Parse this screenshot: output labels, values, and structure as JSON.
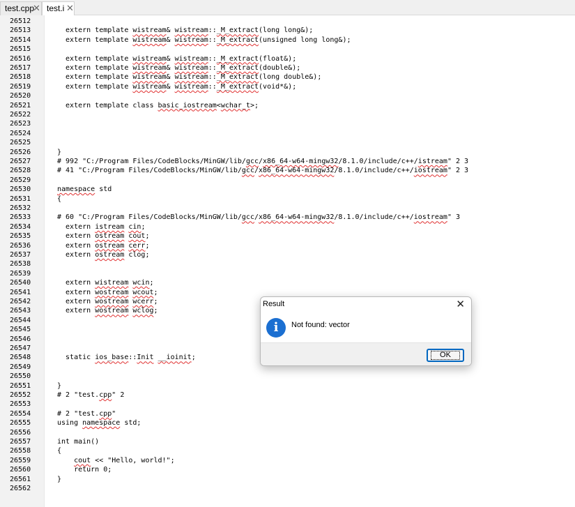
{
  "tabs": [
    {
      "label": "test.cpp",
      "close": "✕"
    },
    {
      "label": "test.i",
      "close": "✕"
    }
  ],
  "editor": {
    "lines": [
      {
        "no": "26512",
        "parts": []
      },
      {
        "no": "26513",
        "parts": [
          {
            "t": "  extern template "
          },
          {
            "t": "wistream",
            "w": true
          },
          {
            "t": "& "
          },
          {
            "t": "wistream",
            "w": true
          },
          {
            "t": "::"
          },
          {
            "t": "_M_extract",
            "w": true
          },
          {
            "t": "(long long&);"
          }
        ]
      },
      {
        "no": "26514",
        "parts": [
          {
            "t": "  extern template "
          },
          {
            "t": "wistream",
            "w": true
          },
          {
            "t": "& "
          },
          {
            "t": "wistream",
            "w": true
          },
          {
            "t": "::"
          },
          {
            "t": "_M_extract",
            "w": true
          },
          {
            "t": "(unsigned long long&);"
          }
        ]
      },
      {
        "no": "26515",
        "parts": []
      },
      {
        "no": "26516",
        "parts": [
          {
            "t": "  extern template "
          },
          {
            "t": "wistream",
            "w": true
          },
          {
            "t": "& "
          },
          {
            "t": "wistream",
            "w": true
          },
          {
            "t": "::"
          },
          {
            "t": "_M_extract",
            "w": true
          },
          {
            "t": "(float&);"
          }
        ]
      },
      {
        "no": "26517",
        "parts": [
          {
            "t": "  extern template "
          },
          {
            "t": "wistream",
            "w": true
          },
          {
            "t": "& "
          },
          {
            "t": "wistream",
            "w": true
          },
          {
            "t": "::"
          },
          {
            "t": "_M_extract",
            "w": true
          },
          {
            "t": "(double&);"
          }
        ]
      },
      {
        "no": "26518",
        "parts": [
          {
            "t": "  extern template "
          },
          {
            "t": "wistream",
            "w": true
          },
          {
            "t": "& "
          },
          {
            "t": "wistream",
            "w": true
          },
          {
            "t": "::"
          },
          {
            "t": "_M_extract",
            "w": true
          },
          {
            "t": "(long double&);"
          }
        ]
      },
      {
        "no": "26519",
        "parts": [
          {
            "t": "  extern template "
          },
          {
            "t": "wistream",
            "w": true
          },
          {
            "t": "& "
          },
          {
            "t": "wistream",
            "w": true
          },
          {
            "t": "::"
          },
          {
            "t": "_M_extract",
            "w": true
          },
          {
            "t": "(void*&);"
          }
        ]
      },
      {
        "no": "26520",
        "parts": []
      },
      {
        "no": "26521",
        "parts": [
          {
            "t": "  extern template class "
          },
          {
            "t": "basic_iostream",
            "w": true
          },
          {
            "t": "<"
          },
          {
            "t": "wchar_t",
            "w": true
          },
          {
            "t": ">;"
          }
        ]
      },
      {
        "no": "26522",
        "parts": []
      },
      {
        "no": "26523",
        "parts": []
      },
      {
        "no": "26524",
        "parts": []
      },
      {
        "no": "26525",
        "parts": []
      },
      {
        "no": "26526",
        "parts": [
          {
            "t": "}"
          }
        ]
      },
      {
        "no": "26527",
        "parts": [
          {
            "t": "# 992 \"C:/Program Files/CodeBlocks/MinGW/lib/"
          },
          {
            "t": "gcc",
            "w": true
          },
          {
            "t": "/"
          },
          {
            "t": "x86_64-w64-mingw32",
            "w": true
          },
          {
            "t": "/8.1.0/include/c++/"
          },
          {
            "t": "istream",
            "w": true
          },
          {
            "t": "\" 2 3"
          }
        ]
      },
      {
        "no": "26528",
        "parts": [
          {
            "t": "# 41 \"C:/Program Files/CodeBlocks/MinGW/lib/"
          },
          {
            "t": "gcc",
            "w": true
          },
          {
            "t": "/"
          },
          {
            "t": "x86_64-w64-mingw32",
            "w": true
          },
          {
            "t": "/8.1.0/include/c++/"
          },
          {
            "t": "iostream",
            "w": true
          },
          {
            "t": "\" 2 3"
          }
        ]
      },
      {
        "no": "26529",
        "parts": []
      },
      {
        "no": "26530",
        "parts": [
          {
            "t": "namespace",
            "w": true
          },
          {
            "t": " std"
          }
        ]
      },
      {
        "no": "26531",
        "parts": [
          {
            "t": "{"
          }
        ]
      },
      {
        "no": "26532",
        "parts": []
      },
      {
        "no": "26533",
        "parts": [
          {
            "t": "# 60 \"C:/Program Files/CodeBlocks/MinGW/lib/"
          },
          {
            "t": "gcc",
            "w": true
          },
          {
            "t": "/"
          },
          {
            "t": "x86_64-w64-mingw32",
            "w": true
          },
          {
            "t": "/8.1.0/include/c++/"
          },
          {
            "t": "iostream",
            "w": true
          },
          {
            "t": "\" 3"
          }
        ]
      },
      {
        "no": "26534",
        "parts": [
          {
            "t": "  extern "
          },
          {
            "t": "istream",
            "w": true
          },
          {
            "t": " "
          },
          {
            "t": "cin",
            "w": true
          },
          {
            "t": ";"
          }
        ]
      },
      {
        "no": "26535",
        "parts": [
          {
            "t": "  extern "
          },
          {
            "t": "ostream",
            "w": true
          },
          {
            "t": " "
          },
          {
            "t": "cout",
            "w": true
          },
          {
            "t": ";"
          }
        ]
      },
      {
        "no": "26536",
        "parts": [
          {
            "t": "  extern "
          },
          {
            "t": "ostream",
            "w": true
          },
          {
            "t": " "
          },
          {
            "t": "cerr",
            "w": true
          },
          {
            "t": ";"
          }
        ]
      },
      {
        "no": "26537",
        "parts": [
          {
            "t": "  extern "
          },
          {
            "t": "ostream",
            "w": true
          },
          {
            "t": " clog;"
          }
        ]
      },
      {
        "no": "26538",
        "parts": []
      },
      {
        "no": "26539",
        "parts": []
      },
      {
        "no": "26540",
        "parts": [
          {
            "t": "  extern "
          },
          {
            "t": "wistream",
            "w": true
          },
          {
            "t": " "
          },
          {
            "t": "wcin",
            "w": true
          },
          {
            "t": ";"
          }
        ]
      },
      {
        "no": "26541",
        "parts": [
          {
            "t": "  extern "
          },
          {
            "t": "wostream",
            "w": true
          },
          {
            "t": " "
          },
          {
            "t": "wcout",
            "w": true
          },
          {
            "t": ";"
          }
        ]
      },
      {
        "no": "26542",
        "parts": [
          {
            "t": "  extern "
          },
          {
            "t": "wostream",
            "w": true
          },
          {
            "t": " "
          },
          {
            "t": "wcerr",
            "w": true
          },
          {
            "t": ";"
          }
        ]
      },
      {
        "no": "26543",
        "parts": [
          {
            "t": "  extern "
          },
          {
            "t": "wostream",
            "w": true
          },
          {
            "t": " "
          },
          {
            "t": "wclog",
            "w": true
          },
          {
            "t": ";"
          }
        ]
      },
      {
        "no": "26544",
        "parts": []
      },
      {
        "no": "26545",
        "parts": []
      },
      {
        "no": "26546",
        "parts": []
      },
      {
        "no": "26547",
        "parts": []
      },
      {
        "no": "26548",
        "parts": [
          {
            "t": "  static "
          },
          {
            "t": "ios_base",
            "w": true
          },
          {
            "t": "::"
          },
          {
            "t": "Init",
            "w": true
          },
          {
            "t": " "
          },
          {
            "t": "__ioinit",
            "w": true
          },
          {
            "t": ";"
          }
        ]
      },
      {
        "no": "26549",
        "parts": []
      },
      {
        "no": "26550",
        "parts": []
      },
      {
        "no": "26551",
        "parts": [
          {
            "t": "}"
          }
        ]
      },
      {
        "no": "26552",
        "parts": [
          {
            "t": "# 2 \"test."
          },
          {
            "t": "cpp",
            "w": true
          },
          {
            "t": "\" 2"
          }
        ]
      },
      {
        "no": "26553",
        "parts": []
      },
      {
        "no": "26554",
        "parts": [
          {
            "t": "# 2 \"test."
          },
          {
            "t": "cpp",
            "w": true
          },
          {
            "t": "\""
          }
        ]
      },
      {
        "no": "26555",
        "parts": [
          {
            "t": "using "
          },
          {
            "t": "namespace",
            "w": true
          },
          {
            "t": " std;"
          }
        ]
      },
      {
        "no": "26556",
        "parts": []
      },
      {
        "no": "26557",
        "parts": [
          {
            "t": "int main()"
          }
        ]
      },
      {
        "no": "26558",
        "parts": [
          {
            "t": "{"
          }
        ]
      },
      {
        "no": "26559",
        "parts": [
          {
            "t": "    "
          },
          {
            "t": "cout",
            "w": true
          },
          {
            "t": " << \"Hello, world!\";"
          }
        ]
      },
      {
        "no": "26560",
        "parts": [
          {
            "t": "    return 0;"
          }
        ]
      },
      {
        "no": "26561",
        "parts": [
          {
            "t": "}"
          }
        ]
      },
      {
        "no": "26562",
        "parts": []
      }
    ]
  },
  "dialog": {
    "title": "Result",
    "close": "✕",
    "icon": "info-icon",
    "icon_glyph": "i",
    "message": "Not found: vector",
    "ok_label": "OK"
  },
  "colors": {
    "squiggle": "#e03030",
    "info_icon": "#1b6fd1",
    "ok_border": "#0067c0"
  }
}
